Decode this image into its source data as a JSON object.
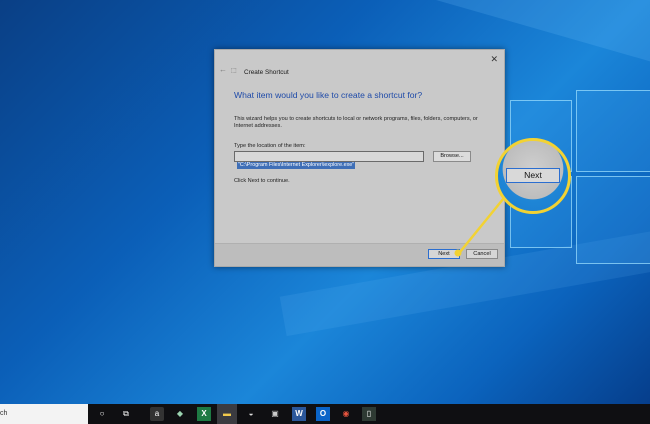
{
  "dialog": {
    "title": "Create Shortcut",
    "back_arrow": "←",
    "close": "✕",
    "heading": "What item would you like to create a shortcut for?",
    "description": "This wizard helps you to create shortcuts to local or network programs, files, folders, computers, or Internet addresses.",
    "location_label": "Type the location of the item:",
    "location_value": "\"C:\\Program Files\\Internet Explorer\\iexplore.exe\"",
    "browse_label": "Browse...",
    "continue_text": "Click Next to continue.",
    "next_label": "Next",
    "cancel_label": "Cancel"
  },
  "callout": {
    "next_label": "Next",
    "accent_color": "#f2d233"
  },
  "taskbar": {
    "search_text": "ch",
    "icons": [
      {
        "name": "cortana-icon",
        "glyph": "○"
      },
      {
        "name": "task-view-icon",
        "glyph": "⧉"
      },
      {
        "name": "amazon-icon",
        "glyph": "a"
      },
      {
        "name": "app-icon",
        "glyph": "◆"
      },
      {
        "name": "excel-icon",
        "glyph": "X"
      },
      {
        "name": "file-explorer-icon",
        "glyph": "▬"
      },
      {
        "name": "drive-icon",
        "glyph": "◒"
      },
      {
        "name": "photos-icon",
        "glyph": "▣"
      },
      {
        "name": "word-icon",
        "glyph": "W"
      },
      {
        "name": "outlook-icon",
        "glyph": "O"
      },
      {
        "name": "chrome-icon",
        "glyph": "◉"
      },
      {
        "name": "app-icon-2",
        "glyph": "▯"
      }
    ]
  }
}
